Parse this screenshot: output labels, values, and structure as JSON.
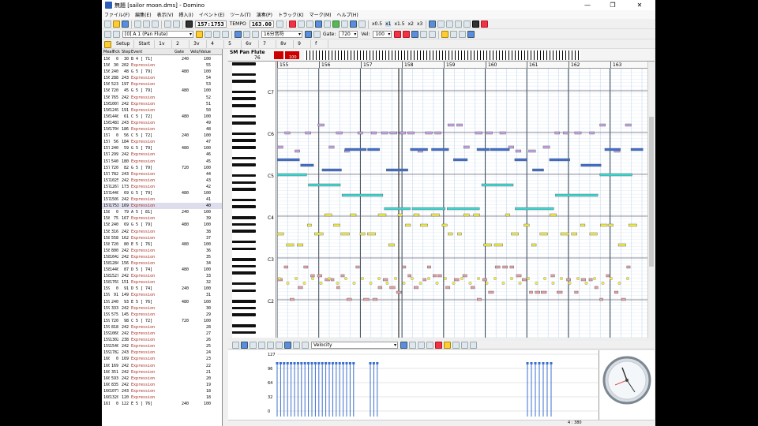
{
  "window": {
    "title": "無題 [sailor moon.dms] - Domino",
    "controls": [
      "—",
      "❐",
      "✕"
    ]
  },
  "menu": [
    "ファイル(F)",
    "編集(E)",
    "表示(V)",
    "挿入(I)",
    "イベント(E)",
    "ツール(T)",
    "演奏(P)",
    "トラック(K)",
    "マーク(M)",
    "ヘルプ(H)"
  ],
  "toolbar1": {
    "position": "157:1753",
    "tempo_label": "TEMPO",
    "tempo": "163.00",
    "zoom": [
      "x0.5",
      "x1",
      "x1.5",
      "x2",
      "x3"
    ]
  },
  "toolbar2": {
    "instrument": "[0] A 1 (Pan Flute)",
    "note_length": "16分音符",
    "gate_label": "Gate:",
    "gate": "720",
    "vel_label": "Vel:",
    "vel": "100"
  },
  "tabs": [
    "Setup",
    "Start",
    "1v",
    "2",
    "3v",
    "4",
    "5",
    "6v",
    "7",
    "8v",
    "9",
    "f"
  ],
  "track_name": "SM Pan Flute",
  "track_vals": [
    "76",
    "100"
  ],
  "event_headers": [
    "Meas",
    "Tick",
    "Step",
    "Event",
    "Gate",
    "Velo/Value"
  ],
  "events": [
    [
      "156",
      "0",
      "30",
      "B  4 [ 71]",
      "240",
      "100"
    ],
    [
      "156",
      "30",
      "202",
      "Expression",
      "",
      "55"
    ],
    [
      "156",
      "240",
      "48",
      "G  5 [ 79]",
      "480",
      "100"
    ],
    [
      "156",
      "288",
      "243",
      "Expression",
      "",
      "54"
    ],
    [
      "156",
      "523",
      "197",
      "Expression",
      "",
      "53"
    ],
    [
      "156",
      "720",
      "45",
      "G  5 [ 79]",
      "480",
      "100"
    ],
    [
      "156",
      "765",
      "242",
      "Expression",
      "",
      "52"
    ],
    [
      "156",
      "1007",
      "242",
      "Expression",
      "",
      "51"
    ],
    [
      "156",
      "1249",
      "191",
      "Expression",
      "",
      "50"
    ],
    [
      "156",
      "1440",
      "61",
      "C  5 [ 72]",
      "480",
      "100"
    ],
    [
      "156",
      "1481",
      "243",
      "Expression",
      "",
      "49"
    ],
    [
      "156",
      "1704",
      "186",
      "Expression",
      "",
      "48"
    ],
    [
      "157",
      "0",
      "56",
      "C  5 [ 72]",
      "240",
      "100"
    ],
    [
      "157",
      "56",
      "184",
      "Expression",
      "",
      "47"
    ],
    [
      "157",
      "240",
      "59",
      "G  5 [ 79]",
      "480",
      "100"
    ],
    [
      "157",
      "299",
      "242",
      "Expression",
      "",
      "46"
    ],
    [
      "157",
      "540",
      "180",
      "Expression",
      "",
      "45"
    ],
    [
      "157",
      "720",
      "82",
      "G  5 [ 79]",
      "720",
      "100"
    ],
    [
      "157",
      "782",
      "243",
      "Expression",
      "",
      "44"
    ],
    [
      "157",
      "1025",
      "242",
      "Expression",
      "",
      "43"
    ],
    [
      "157",
      "1267",
      "173",
      "Expression",
      "",
      "42"
    ],
    [
      "157",
      "1440",
      "69",
      "G  5 [ 79]",
      "480",
      "100"
    ],
    [
      "157",
      "1509",
      "242",
      "Expression",
      "",
      "41"
    ],
    [
      "157",
      "1751",
      "169",
      "Expression",
      "",
      "40"
    ],
    [
      "158",
      "0",
      "79",
      "A  5 [ 81]",
      "240",
      "100"
    ],
    [
      "158",
      "75",
      "167",
      "Expression",
      "",
      "39"
    ],
    [
      "158",
      "240",
      "69",
      "G  5 [ 79]",
      "480",
      "100"
    ],
    [
      "158",
      "316",
      "242",
      "Expression",
      "",
      "38"
    ],
    [
      "158",
      "558",
      "162",
      "Expression",
      "",
      "37"
    ],
    [
      "158",
      "720",
      "80",
      "E  5 [ 76]",
      "480",
      "100"
    ],
    [
      "158",
      "800",
      "242",
      "Expression",
      "",
      "36"
    ],
    [
      "158",
      "1042",
      "242",
      "Expression",
      "",
      "35"
    ],
    [
      "158",
      "1284",
      "156",
      "Expression",
      "",
      "34"
    ],
    [
      "158",
      "1440",
      "87",
      "D  5 [ 74]",
      "480",
      "100"
    ],
    [
      "158",
      "1527",
      "242",
      "Expression",
      "",
      "33"
    ],
    [
      "158",
      "1769",
      "151",
      "Expression",
      "",
      "32"
    ],
    [
      "159",
      "0",
      "91",
      "D  5 [ 74]",
      "240",
      "100"
    ],
    [
      "159",
      "91",
      "149",
      "Expression",
      "",
      "31"
    ],
    [
      "159",
      "240",
      "93",
      "E  5 [ 76]",
      "480",
      "100"
    ],
    [
      "159",
      "333",
      "242",
      "Expression",
      "",
      "30"
    ],
    [
      "159",
      "575",
      "145",
      "Expression",
      "",
      "29"
    ],
    [
      "159",
      "720",
      "98",
      "C  5 [ 72]",
      "720",
      "100"
    ],
    [
      "159",
      "818",
      "242",
      "Expression",
      "",
      "28"
    ],
    [
      "159",
      "1060",
      "242",
      "Expression",
      "",
      "27"
    ],
    [
      "159",
      "1302",
      "238",
      "Expression",
      "",
      "26"
    ],
    [
      "159",
      "1540",
      "242",
      "Expression",
      "",
      "25"
    ],
    [
      "159",
      "1782",
      "243",
      "Expression",
      "",
      "24"
    ],
    [
      "160",
      "0",
      "169",
      "Expression",
      "",
      "23"
    ],
    [
      "160",
      "169",
      "242",
      "Expression",
      "",
      "22"
    ],
    [
      "160",
      "351",
      "242",
      "Expression",
      "",
      "21"
    ],
    [
      "160",
      "593",
      "242",
      "Expression",
      "",
      "20"
    ],
    [
      "160",
      "835",
      "242",
      "Expression",
      "",
      "19"
    ],
    [
      "160",
      "1077",
      "243",
      "Expression",
      "",
      "18"
    ],
    [
      "160",
      "1320",
      "120",
      "Expression",
      "",
      "18"
    ],
    [
      "161",
      "0",
      "122",
      "E  5 [ 76]",
      "240",
      "100"
    ]
  ],
  "octave_labels": [
    "C7",
    "C6",
    "C5",
    "C4",
    "C3",
    "C2"
  ],
  "measure_numbers": [
    "155",
    "156",
    "157",
    "158",
    "159",
    "160",
    "161",
    "162",
    "163"
  ],
  "velocity_panel": {
    "mode": "Velocity",
    "y_ticks": [
      "127",
      "96",
      "64",
      "32",
      "0"
    ]
  },
  "status": {
    "position": "4 : 380"
  },
  "colors": {
    "note_high": "#c7a3e6",
    "note_blue": "#3f6fd0",
    "note_cyan": "#3fd9d3",
    "note_yellow": "#f4ee4a",
    "note_red": "#e6a0a4",
    "grid": "#bcd2ea"
  }
}
